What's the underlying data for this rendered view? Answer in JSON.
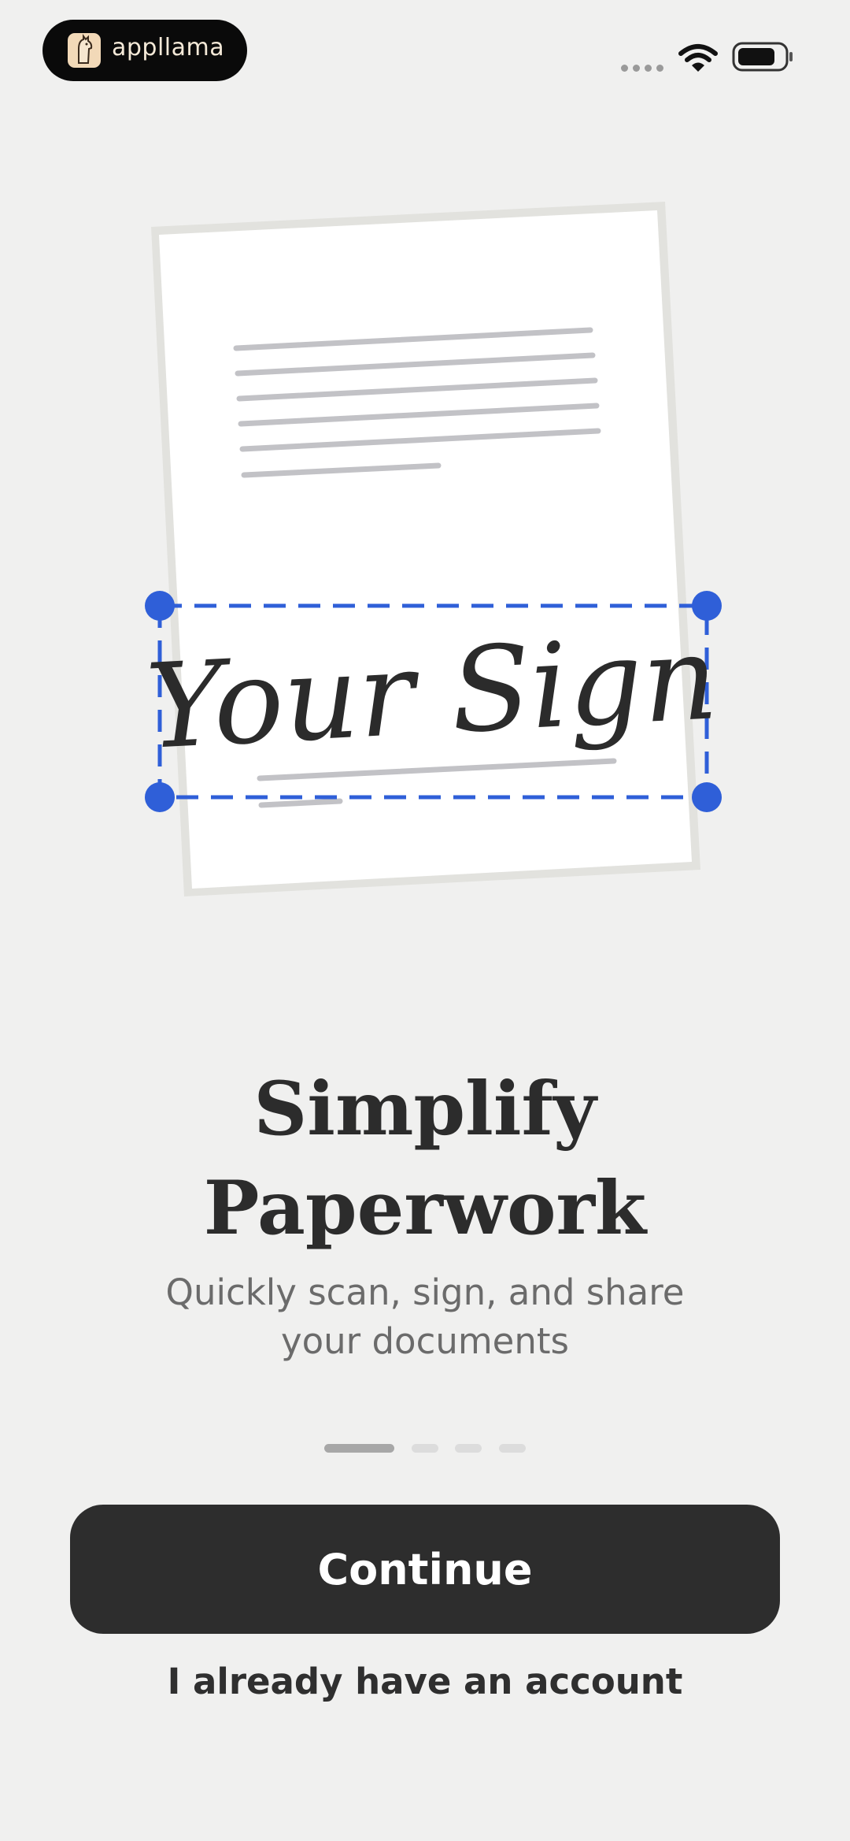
{
  "status_bar": {
    "brand_name": "appllama",
    "icons": [
      "signal-dots-icon",
      "wifi-icon",
      "battery-icon"
    ]
  },
  "illustration": {
    "signature_text": "Your Sign",
    "handles": [
      "top-left",
      "top-right",
      "bottom-left",
      "bottom-right"
    ]
  },
  "onboarding": {
    "title_line1": "Simplify",
    "title_line2": "Paperwork",
    "subtitle_line1": "Quickly scan, sign, and share",
    "subtitle_line2": "your documents",
    "page_count": 4,
    "current_page": 1
  },
  "actions": {
    "continue_label": "Continue",
    "login_label": "I already have an account"
  },
  "colors": {
    "background": "#f0f0ef",
    "primary_button": "#2d2d2d",
    "selection_blue": "#2f5fd8",
    "text_dark": "#2c2c2c",
    "text_muted": "#6b6b6b"
  }
}
